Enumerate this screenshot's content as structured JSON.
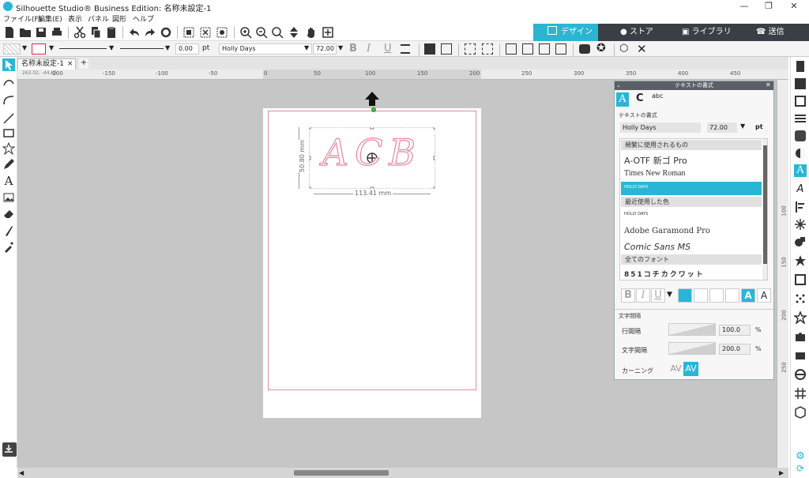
{
  "window": {
    "title": "Silhouette Studio® Business Edition: 名称未設定-1",
    "controls": [
      "—",
      "❐",
      "✕"
    ]
  },
  "menu": {
    "items": [
      "ファイル(F)",
      "編集(E)",
      "表示",
      "パネル",
      "図形",
      "ヘルプ"
    ]
  },
  "right_tabs": {
    "design": "デザイン",
    "store": "ストア",
    "library": "ライブラリ",
    "send": "送信"
  },
  "propbar": {
    "line_width": "0.00",
    "unit": "pt",
    "font_name": "Holly Days",
    "font_size": "72.00",
    "bold": "B",
    "italic": "I",
    "underline": "U"
  },
  "document": {
    "tab_label": "名称未設定-1",
    "close": "×",
    "add": "+",
    "coords": "263.02, -44.85"
  },
  "ruler": {
    "labels": [
      "-200",
      "-150",
      "-100",
      "-50",
      "0",
      "50",
      "100",
      "150",
      "200",
      "250",
      "300",
      "350",
      "400",
      "450"
    ],
    "vlabels": [
      "100",
      "150",
      "200",
      "250"
    ]
  },
  "artwork": {
    "text": "ACB",
    "width_label": "113.41 mm",
    "height_label": "50.80 mm"
  },
  "colors": {
    "accent": "#29b6d6",
    "dark": "#3b3f45",
    "cut_line": "#e8879b",
    "canvas": "#c6c6c6"
  },
  "panel": {
    "title": "テキストの書式",
    "section_label": "テキストの書式",
    "font_name": "Holly Days",
    "font_size": "72.00",
    "size_unit": "pt",
    "frequent_header": "頻繁に使用されるもの",
    "frequent_fonts": [
      "A-OTF 新ゴ Pro",
      "Times New Roman",
      "HOLLY DAYS"
    ],
    "recent_header": "最近使用した色",
    "recent_fonts": [
      "HOLLY DAYS",
      "Adobe Garamond Pro",
      "Comic Sans MS"
    ],
    "all_header": "全てのフォント",
    "all_fonts": [
      "851コチカクワット"
    ],
    "style_buttons": [
      "B",
      "I",
      "U"
    ],
    "spacing_header": "文字間隔",
    "line_spacing_label": "行間隔",
    "line_spacing_value": "100.0",
    "char_spacing_label": "文字間隔",
    "char_spacing_value": "200.0",
    "percent": "%",
    "kerning_label": "カーニング",
    "kerning_values": [
      "AV",
      "AV"
    ]
  }
}
